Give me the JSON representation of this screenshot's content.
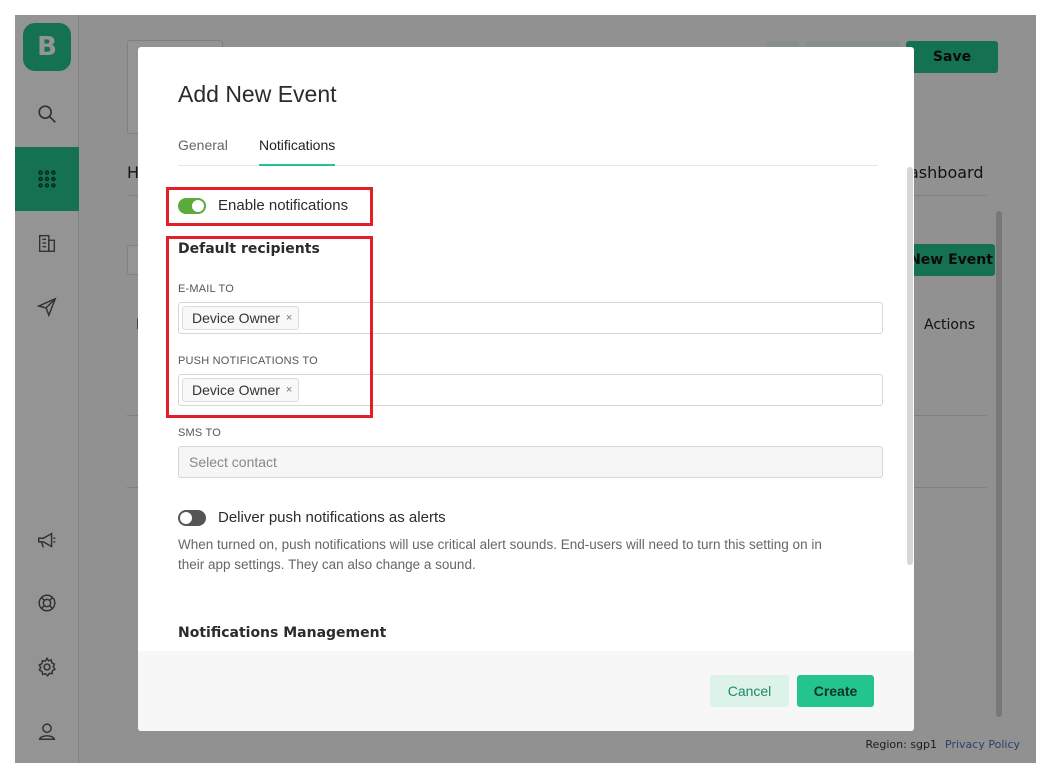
{
  "sidebar": {
    "logo_letter": "B",
    "items": [
      {
        "icon": "search-icon"
      },
      {
        "icon": "grid-icon",
        "active": true
      },
      {
        "icon": "building-icon"
      },
      {
        "icon": "paper-plane-icon"
      },
      {
        "icon": "megaphone-icon"
      },
      {
        "icon": "lifebuoy-icon"
      },
      {
        "icon": "gear-icon"
      },
      {
        "icon": "user-icon"
      }
    ]
  },
  "background": {
    "save_label": "Save",
    "new_event_label": "New Event",
    "dashboard_tab_fragment": "ashboard",
    "actions_header": "Actions",
    "heading_fragment": "H",
    "col_fragment": "N"
  },
  "footer": {
    "region": "Region: sgp1",
    "privacy": "Privacy Policy"
  },
  "modal": {
    "title": "Add New Event",
    "tabs": [
      {
        "label": "General",
        "active": false
      },
      {
        "label": "Notifications",
        "active": true
      }
    ],
    "enable_notifications": {
      "label": "Enable notifications",
      "on": true
    },
    "default_recipients_heading": "Default recipients",
    "email_to": {
      "label": "E-MAIL TO",
      "chip": "Device Owner",
      "remove": "×"
    },
    "push_to": {
      "label": "PUSH NOTIFICATIONS TO",
      "chip": "Device Owner",
      "remove": "×"
    },
    "sms_to": {
      "label": "SMS TO",
      "placeholder": "Select contact"
    },
    "deliver_alerts": {
      "label": "Deliver push notifications as alerts",
      "on": false,
      "description_line1": "When turned on, push notifications will use critical alert sounds. End-users will need to turn this setting on in",
      "description_line2": "their app settings. They can also change a sound."
    },
    "notifications_management_heading": "Notifications Management",
    "cancel_label": "Cancel",
    "create_label": "Create"
  },
  "colors": {
    "accent": "#23c48e",
    "toggle_on": "#5aab3b",
    "highlight": "#e3202a"
  }
}
